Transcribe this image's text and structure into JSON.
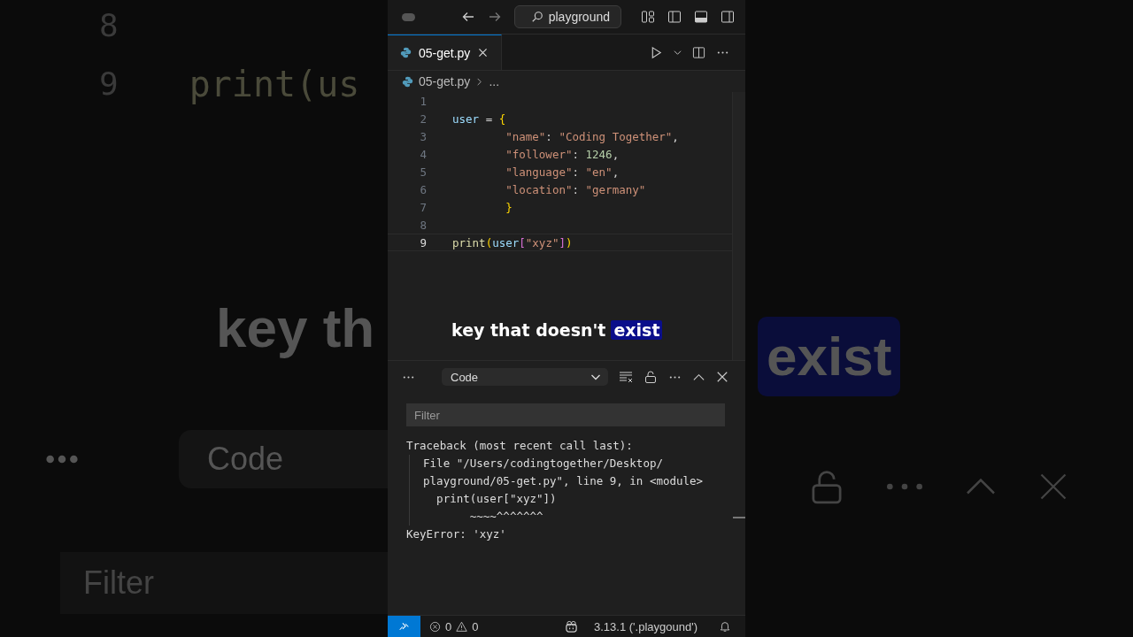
{
  "backdrop_left": {
    "line_numbers": [
      "8",
      "9"
    ],
    "code": "print(us",
    "caption": "key th",
    "dropdown": "Code",
    "filter": "Filter"
  },
  "backdrop_right": {
    "caption": "exist"
  },
  "title_bar": {
    "search": "playground"
  },
  "tabs": [
    {
      "label": "05-get.py",
      "selected": true
    }
  ],
  "breadcrumb": {
    "file": "05-get.py",
    "more": "..."
  },
  "editor": {
    "lines": [
      {
        "number": "1",
        "current": false
      },
      {
        "number": "2",
        "current": false,
        "tokens": [
          {
            "text": "user",
            "kind": "var"
          },
          {
            "text": " = ",
            "kind": "plain"
          },
          {
            "text": "{",
            "kind": "brace"
          }
        ]
      },
      {
        "number": "3",
        "current": false,
        "tokens": [
          {
            "text": "        \"name\"",
            "kind": "string"
          },
          {
            "text": ": ",
            "kind": "plain"
          },
          {
            "text": "\"Coding Together\"",
            "kind": "string"
          },
          {
            "text": ",",
            "kind": "plain"
          }
        ]
      },
      {
        "number": "4",
        "current": false,
        "tokens": [
          {
            "text": "        \"follower\"",
            "kind": "string"
          },
          {
            "text": ": ",
            "kind": "plain"
          },
          {
            "text": "1246",
            "kind": "number"
          },
          {
            "text": ",",
            "kind": "plain"
          }
        ]
      },
      {
        "number": "5",
        "current": false,
        "tokens": [
          {
            "text": "        \"language\"",
            "kind": "string"
          },
          {
            "text": ": ",
            "kind": "plain"
          },
          {
            "text": "\"en\"",
            "kind": "string"
          },
          {
            "text": ",",
            "kind": "plain"
          }
        ]
      },
      {
        "number": "6",
        "current": false,
        "tokens": [
          {
            "text": "        \"location\"",
            "kind": "string"
          },
          {
            "text": ": ",
            "kind": "plain"
          },
          {
            "text": "\"germany\"",
            "kind": "string"
          }
        ]
      },
      {
        "number": "7",
        "current": false,
        "tokens": [
          {
            "text": "        }",
            "kind": "brace"
          }
        ]
      },
      {
        "number": "8",
        "current": false
      },
      {
        "number": "9",
        "current": true,
        "tokens": [
          {
            "text": "print",
            "kind": "func"
          },
          {
            "text": "(",
            "kind": "brace"
          },
          {
            "text": "user",
            "kind": "var"
          },
          {
            "text": "[",
            "kind": "bracket"
          },
          {
            "text": "\"xyz\"",
            "kind": "string"
          },
          {
            "text": "]",
            "kind": "bracket"
          },
          {
            "text": ")",
            "kind": "brace"
          }
        ]
      }
    ]
  },
  "caption": {
    "text": "key that doesn't",
    "highlight": "exist"
  },
  "panel": {
    "dropdown": "Code",
    "filter": {
      "placeholder": "Filter"
    },
    "output": [
      {
        "text": "Traceback (most recent call last):",
        "indent": false
      },
      {
        "text": "  File \"/Users/codingtogether/Desktop/",
        "indent": true
      },
      {
        "text": "  playground/05-get.py\", line 9, in <module>",
        "indent": true
      },
      {
        "text": "    print(user[\"xyz\"])",
        "indent": true
      },
      {
        "text": "         ~~~~^^^^^^^",
        "indent": true
      },
      {
        "text": "KeyError: 'xyz'",
        "indent": false
      }
    ]
  },
  "status_bar": {
    "errors": "0",
    "warnings": "0",
    "interpreter": "3.13.1 ('.playgound')"
  }
}
